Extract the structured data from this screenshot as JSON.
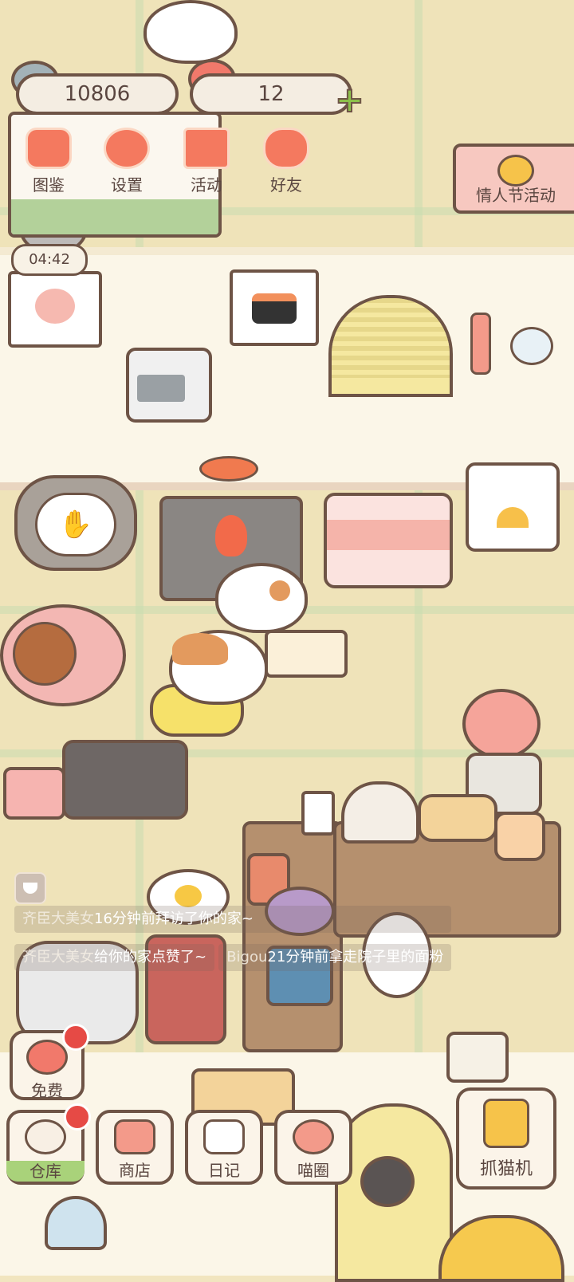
{
  "currency": {
    "coins": "10806",
    "hearts": "12",
    "add_label": "+"
  },
  "menu": [
    {
      "label": "图鉴",
      "icon": "cat-book-icon"
    },
    {
      "label": "设置",
      "icon": "gear-icon"
    },
    {
      "label": "活动",
      "icon": "gift-icon"
    },
    {
      "label": "好友",
      "icon": "friends-icon"
    }
  ],
  "event_banner": {
    "label": "情人节活动",
    "icon": "heart-cookie-icon"
  },
  "timer": "04:42",
  "feed": [
    {
      "name": "齐臣大美女",
      "text": "16分钟前拜访了你的家~"
    },
    {
      "name": "齐臣大美女",
      "text": "给你的家点赞了~"
    },
    {
      "name": "Bigou",
      "text": "21分钟前拿走院子里的面粉"
    }
  ],
  "nav": {
    "free": {
      "label": "免费",
      "icon": "heart-icon"
    },
    "items": [
      {
        "label": "仓库",
        "icon": "storage-icon"
      },
      {
        "label": "商店",
        "icon": "shop-icon"
      },
      {
        "label": "日记",
        "icon": "diary-icon"
      },
      {
        "label": "喵圈",
        "icon": "planet-cat-icon"
      }
    ],
    "claw": {
      "label": "抓猫机",
      "icon": "claw-icon"
    }
  },
  "colors": {
    "outline": "#6e5446",
    "accent_pink": "#f4795f",
    "badge_red": "#e64a45",
    "active_green": "#a9d27a"
  }
}
